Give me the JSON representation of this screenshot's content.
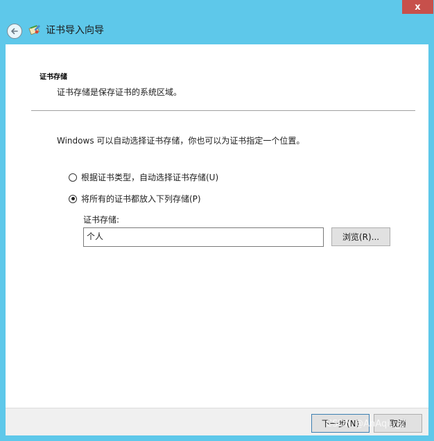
{
  "window": {
    "close_label": "x"
  },
  "header": {
    "title": "证书导入向导"
  },
  "section": {
    "heading": "证书存储",
    "description": "证书存储是保存证书的系统区域。"
  },
  "intro": "Windows 可以自动选择证书存储，你也可以为证书指定一个位置。",
  "options": [
    {
      "label": "根据证书类型，自动选择证书存储(U)",
      "checked": false
    },
    {
      "label": "将所有的证书都放入下列存储(P)",
      "checked": true
    }
  ],
  "store": {
    "label": "证书存储:",
    "value": "个人",
    "browse_label": "浏览(R)..."
  },
  "footer": {
    "next_label": "下一步(N)",
    "cancel_label": "取消"
  },
  "watermark": "CSDN @AnAqiu_Z",
  "icons": {
    "back": "back-arrow-icon",
    "wizard": "certificate-wizard-icon",
    "close": "close-icon"
  },
  "colors": {
    "frame": "#5ec8ea",
    "close_button": "#c7504b",
    "content_bg": "#ffffff",
    "footer_bg": "#f0f0f0"
  }
}
